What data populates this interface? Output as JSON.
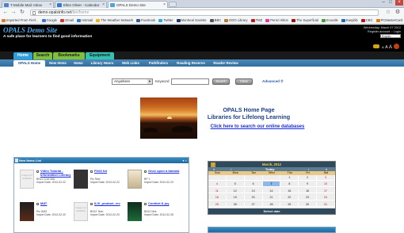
{
  "browser": {
    "tabs": [
      {
        "label": "T-Mobile Mail: Inbox",
        "color": "#4b84c6"
      },
      {
        "label": "Ellen Oliver - Calendar",
        "color": "#3a78d0"
      },
      {
        "label": "OPALS Demo Site",
        "color": "#4fa4dc"
      }
    ],
    "url": "demo.opalsinfo.net",
    "url_path": "/bin/home",
    "bookmarks": [
      {
        "label": "Imported From Firef...",
        "color": "#e07a28"
      },
      {
        "label": "Google",
        "color": "#3a76d4"
      },
      {
        "label": "Gmail",
        "color": "#d23a2c"
      },
      {
        "label": "Hotmail",
        "color": "#2f7ccb"
      },
      {
        "label": "The Weather Network",
        "color": "#f2b11a"
      },
      {
        "label": "Facebook",
        "color": "#3b5998"
      },
      {
        "label": "Twitter",
        "color": "#33a8e0"
      },
      {
        "label": "Montreal Gazette",
        "color": "#1a3a6a"
      },
      {
        "label": "BBC",
        "color": "#555555"
      },
      {
        "label": "DDO Library",
        "color": "#b37d32"
      },
      {
        "label": "TMZ",
        "color": "#c01818"
      },
      {
        "label": "Perez Hilton",
        "color": "#e03a9a"
      },
      {
        "label": "The Superficial",
        "color": "#9a1010"
      },
      {
        "label": "Ecoutile",
        "color": "#4a9a3a"
      },
      {
        "label": "Easybib",
        "color": "#1a6ab8"
      },
      {
        "label": "CBC",
        "color": "#c01010"
      },
      {
        "label": "PCMasterCard",
        "color": "#e07a10"
      }
    ]
  },
  "site": {
    "logo": "OPALS Demo Site",
    "tagline": "A safe place for learners to find good information",
    "date": "Wednesday, March 07 2012",
    "account": "Register account :: Login",
    "language": "English"
  },
  "main_menu": {
    "tabs": [
      {
        "label": "Home",
        "bg": "#2d9fdb",
        "fg": "#ffffff"
      },
      {
        "label": "Search",
        "bg": "#7fc13d",
        "fg": "#1a1a1a"
      },
      {
        "label": "Bookmarks",
        "bg": "#7fc13d",
        "fg": "#1a1a1a"
      },
      {
        "label": "Equipment",
        "bg": "#33c1b1",
        "fg": "#1a1a1a"
      }
    ]
  },
  "sub_menu": {
    "items": [
      "OPALS Home",
      "New Items",
      "News",
      "Library Hours",
      "Web Links",
      "Pathfinders",
      "Reading Reserve",
      "Reader Review"
    ]
  },
  "search": {
    "scope": "Anywhere",
    "keyword_label": "Keyword",
    "search_button": "Search",
    "clear_button": "Clear",
    "advanced_link": "Advanced"
  },
  "home": {
    "title_line1": "OPALS Home Page",
    "title_line2": "Libraries for Lifelong Learning",
    "db_link": "Click here to search our online databases"
  },
  "new_items": {
    "title": "New Items List",
    "items": [
      {
        "title": "Video Tutorial - Information Literacy",
        "meta1": "BS11 COA 30A",
        "meta2": "Import Date: 2012-02-22",
        "cover": "noimg",
        "cover_text": "Image not available"
      },
      {
        "title": "Flirt3 fot",
        "meta1": "Pic Sext",
        "meta2": "Import Date: 2012-02-22",
        "cover": "dark",
        "cover_text": ""
      },
      {
        "title": "Once upon a banana",
        "meta1": "BP 1",
        "meta2": "Import Date: 2012-02-23",
        "cover": "pale",
        "cover_text": ""
      },
      {
        "title": "MAT",
        "meta1": "Pic GM3",
        "meta2": "Import Date: 2012-02-20",
        "cover": "dark2",
        "cover_text": ""
      },
      {
        "title": "ILIX_product_rev",
        "meta1": "BS12 Tech",
        "meta2": "Import Date: 2012-02-20",
        "cover": "noimg",
        "cover_text": "Image not available"
      },
      {
        "title": "Comfort & joy",
        "meta1": "BS12 Nhe",
        "meta2": "Import Date: 2012-02-28",
        "cover": "green",
        "cover_text": ""
      }
    ]
  },
  "calendar": {
    "title": "March, 2012",
    "nav": [
      "«",
      "‹",
      "Today",
      "›",
      "»"
    ],
    "dow": [
      "Sun",
      "Mon",
      "Tue",
      "Wed",
      "Thu",
      "Fri",
      "Sat"
    ],
    "weeks": [
      [
        "",
        "",
        "",
        "",
        "1",
        "2",
        "3"
      ],
      [
        "4",
        "5",
        "6",
        "7",
        "8",
        "9",
        "10"
      ],
      [
        "11",
        "12",
        "13",
        "14",
        "15",
        "16",
        "17"
      ],
      [
        "18",
        "19",
        "20",
        "21",
        "22",
        "23",
        "24"
      ],
      [
        "25",
        "26",
        "27",
        "28",
        "29",
        "30",
        "31"
      ]
    ],
    "today": "7",
    "footer": "Select date"
  }
}
